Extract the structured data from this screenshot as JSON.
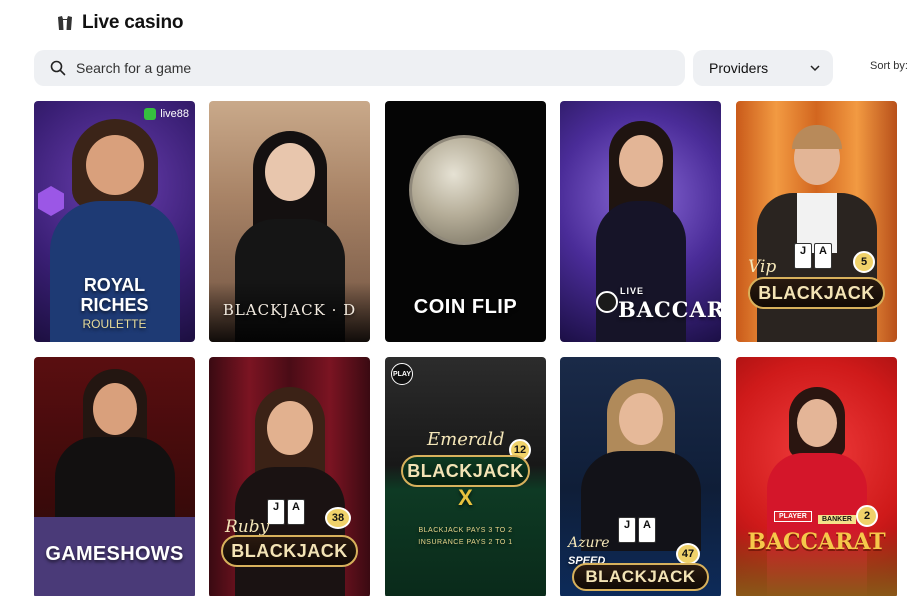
{
  "header": {
    "title": "Live casino",
    "icon": "casino-table-icon"
  },
  "search": {
    "placeholder": "Search for a game",
    "value": ""
  },
  "providers": {
    "label": "Providers"
  },
  "sort": {
    "label": "Sort by:"
  },
  "games": [
    {
      "title_line1": "ROYAL",
      "title_line2": "RICHES",
      "subtitle": "ROULETTE",
      "provider": "live88"
    },
    {
      "title": "BLACKJACK · D"
    },
    {
      "title": "COIN FLIP"
    },
    {
      "badge": "LIVE",
      "title": "BACCARAT"
    },
    {
      "prefix": "Vip",
      "title": "BLACKJACK",
      "number": "5",
      "cards": [
        "J",
        "A"
      ]
    },
    {
      "title": "GAMESHOWS"
    },
    {
      "prefix": "Ruby",
      "title": "BLACKJACK",
      "number": "38",
      "cards": [
        "J",
        "A"
      ]
    },
    {
      "prefix": "Emerald",
      "title": "BLACKJACK",
      "suffix": "X",
      "number": "12",
      "badge": "PLAY",
      "footer_line1": "BLACKJACK PAYS 3 TO 2",
      "footer_line2": "INSURANCE PAYS 2 TO 1"
    },
    {
      "prefix": "Azure",
      "line_above": "SPEED",
      "title": "BLACKJACK",
      "number": "47",
      "cards": [
        "J",
        "A"
      ]
    },
    {
      "tag_left": "PLAYER",
      "tag_right": "BANKER",
      "title": "BACCARAT",
      "number": "2"
    }
  ],
  "colors": {
    "search_bg": "#eef0f3",
    "gold": "#d8b15c",
    "provider_green": "#36c03f"
  }
}
